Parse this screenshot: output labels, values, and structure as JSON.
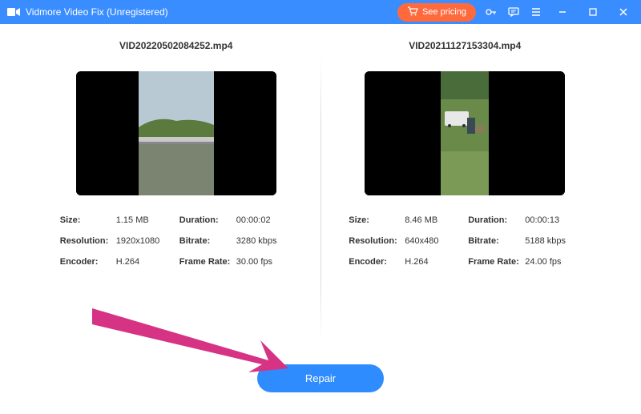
{
  "titlebar": {
    "app_name": "Vidmore Video Fix (Unregistered)",
    "pricing_label": "See pricing"
  },
  "left": {
    "filename": "VID20220502084252.mp4",
    "size_label": "Size:",
    "size": "1.15 MB",
    "duration_label": "Duration:",
    "duration": "00:00:02",
    "resolution_label": "Resolution:",
    "resolution": "1920x1080",
    "bitrate_label": "Bitrate:",
    "bitrate": "3280 kbps",
    "encoder_label": "Encoder:",
    "encoder": "H.264",
    "framerate_label": "Frame Rate:",
    "framerate": "30.00 fps"
  },
  "right": {
    "filename": "VID20211127153304.mp4",
    "size_label": "Size:",
    "size": "8.46 MB",
    "duration_label": "Duration:",
    "duration": "00:00:13",
    "resolution_label": "Resolution:",
    "resolution": "640x480",
    "bitrate_label": "Bitrate:",
    "bitrate": "5188 kbps",
    "encoder_label": "Encoder:",
    "encoder": "H.264",
    "framerate_label": "Frame Rate:",
    "framerate": "24.00 fps"
  },
  "footer": {
    "repair_label": "Repair"
  },
  "colors": {
    "accent": "#2f8cff",
    "arrow": "#d63384"
  }
}
